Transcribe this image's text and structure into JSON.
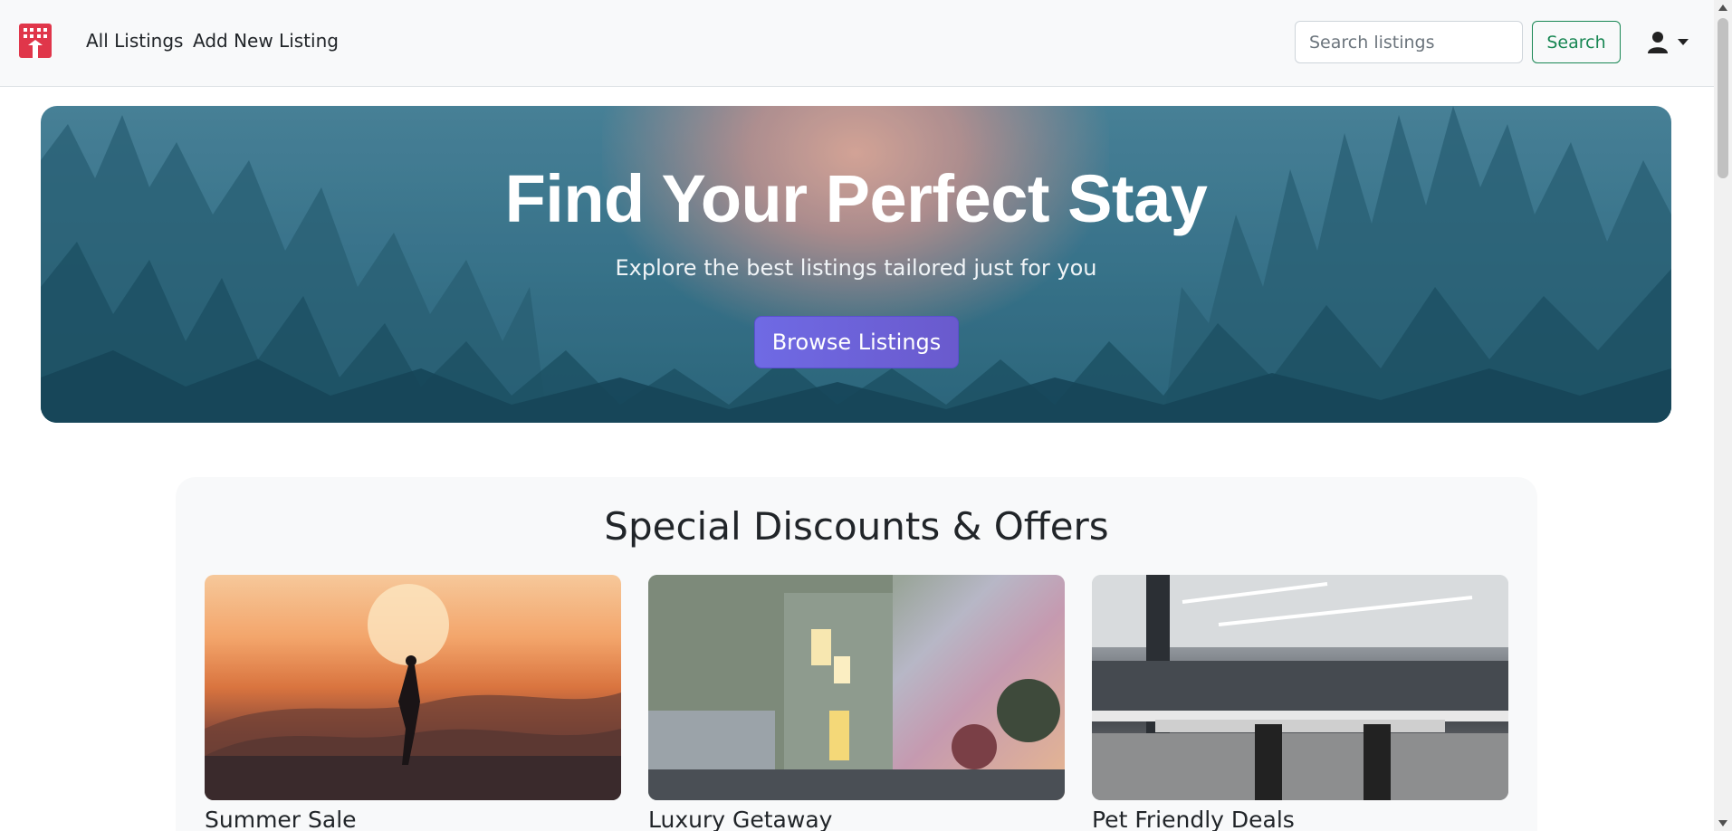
{
  "navbar": {
    "logo_icon": "hotel-building-icon",
    "brand_color": "#e0364a",
    "links": [
      "All Listings",
      "Add New Listing"
    ],
    "search": {
      "placeholder": "Search listings",
      "value": "",
      "button_label": "Search",
      "button_color": "#198754"
    },
    "user_menu": {
      "icon": "user-icon",
      "caret": "caret-down-icon"
    }
  },
  "hero": {
    "title": "Find Your Perfect Stay",
    "subtitle": "Explore the best listings tailored just for you",
    "button_label": "Browse Listings",
    "button_color": "#6a5acd"
  },
  "offers": {
    "title": "Special Discounts & Offers",
    "cards": [
      {
        "label": "Summer Sale"
      },
      {
        "label": "Luxury Getaway"
      },
      {
        "label": "Pet Friendly Deals"
      }
    ]
  }
}
